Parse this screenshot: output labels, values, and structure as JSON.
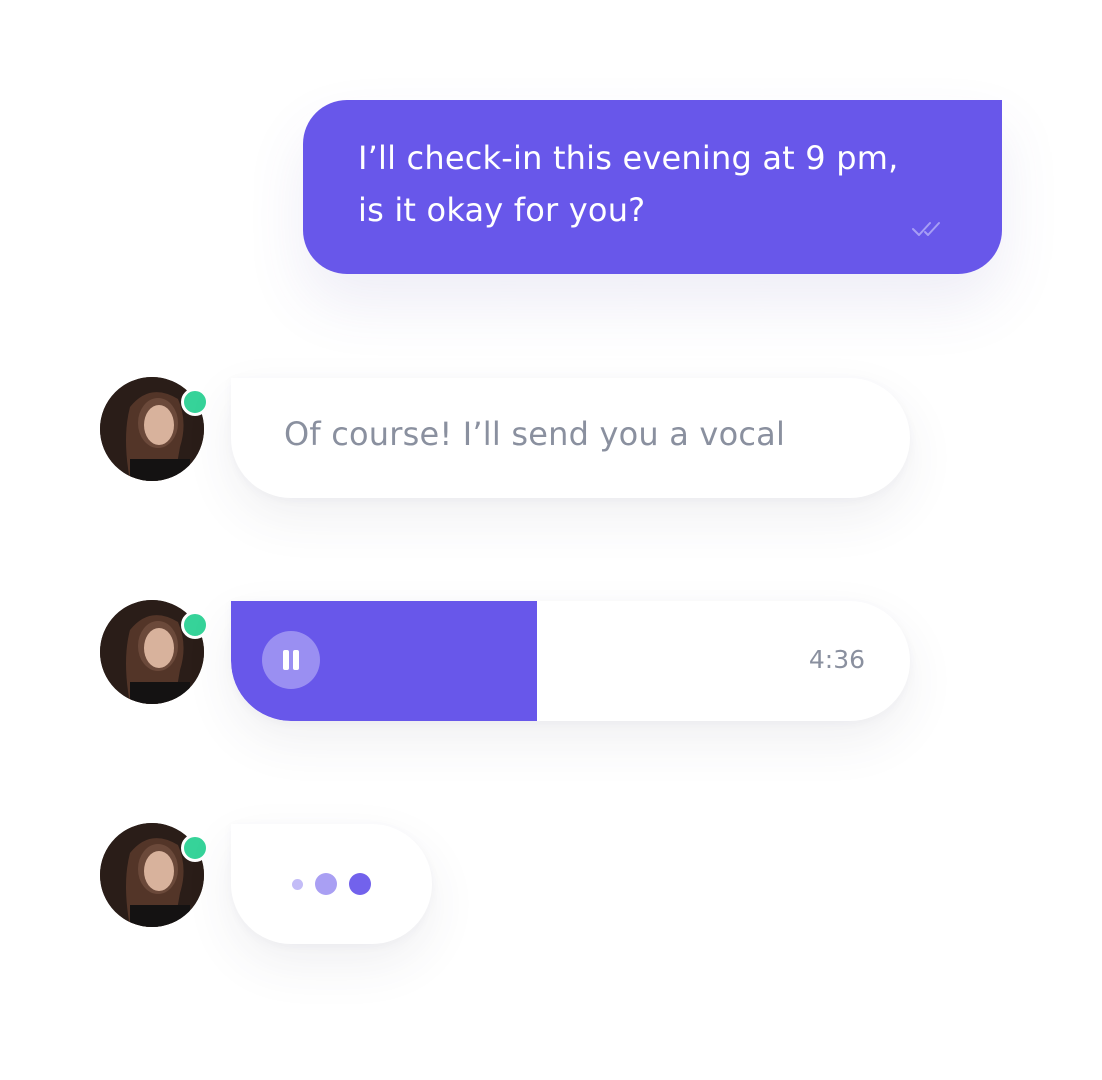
{
  "messages": {
    "outgoing_text": "I’ll check-in this evening at 9 pm,\nis it okay for you?",
    "incoming_text": "Of course! I’ll send you a vocal",
    "voice_duration": "4:36",
    "voice_progress_fraction": 0.45
  },
  "icons": {
    "read_status": "double-check-icon",
    "pause": "pause-icon",
    "presence": "online-status-dot"
  },
  "colors": {
    "accent": "#6857ea",
    "online": "#36d399",
    "muted_text": "#8a909f"
  }
}
